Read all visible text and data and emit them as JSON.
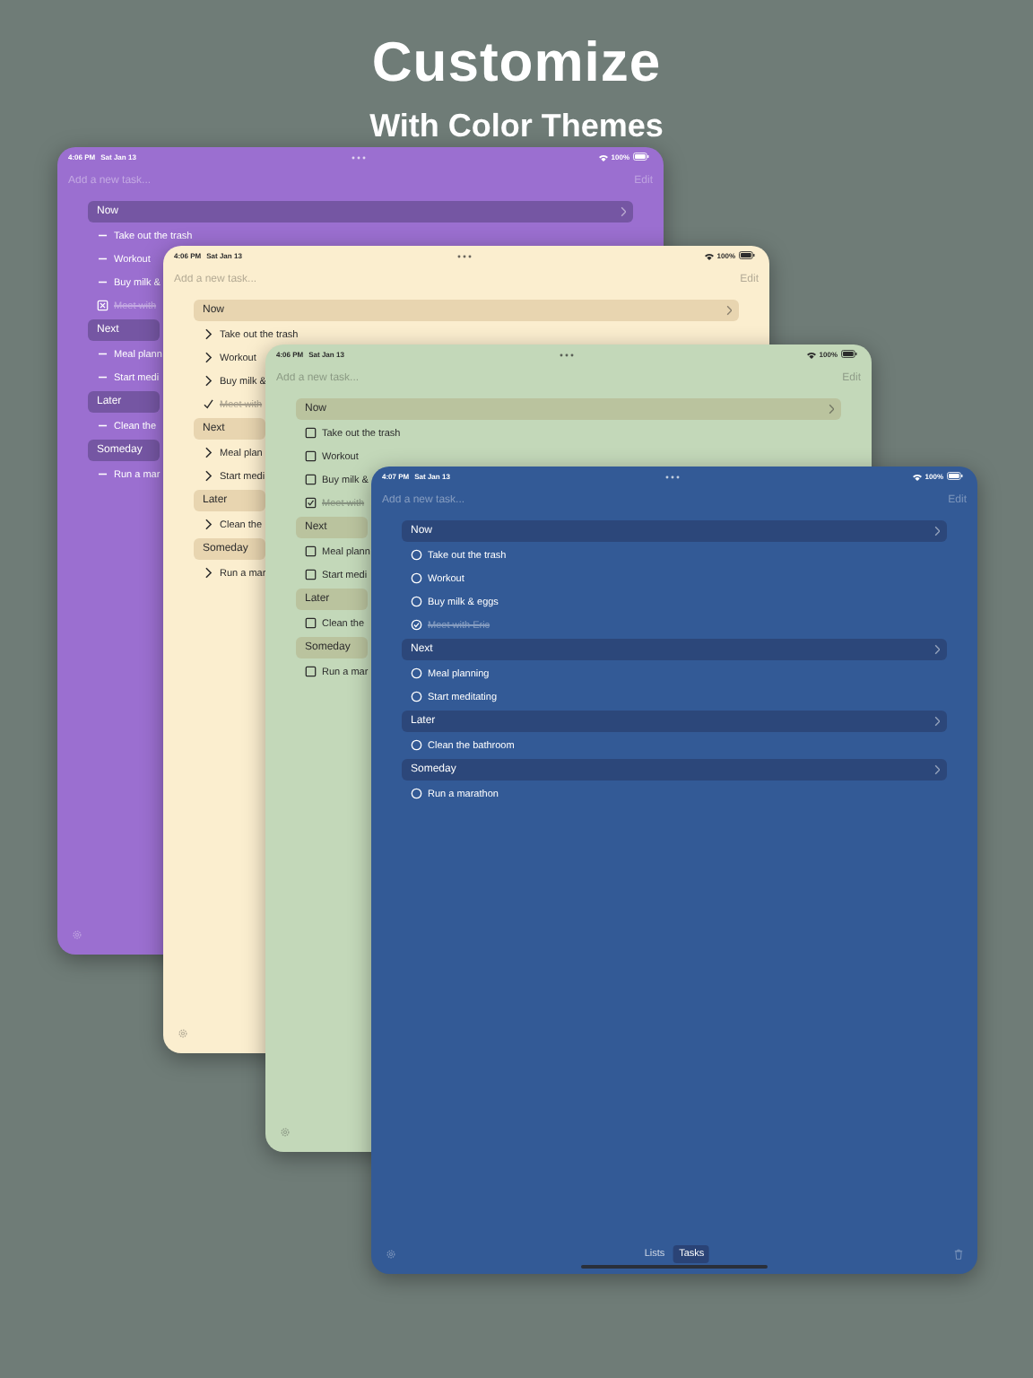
{
  "heading": {
    "title": "Customize",
    "subtitle": "With Color Themes"
  },
  "screens": [
    {
      "color": "#9b6fd0",
      "kind": "dash",
      "status": {
        "time": "4:06 PM",
        "date": "Sat Jan 13",
        "battery": "100%"
      },
      "input": {
        "placeholder": "Add a new task..."
      },
      "edit": "Edit",
      "groups": [
        {
          "title": "Now",
          "tasks": [
            {
              "text": "Take out the trash",
              "done": false
            },
            {
              "text": "Workout",
              "done": false
            },
            {
              "text": "Buy milk &",
              "done": false
            },
            {
              "text": "Meet with",
              "done": true
            }
          ]
        },
        {
          "title": "Next",
          "tasks": [
            {
              "text": "Meal plann",
              "done": false
            },
            {
              "text": "Start medi",
              "done": false
            }
          ]
        },
        {
          "title": "Later",
          "tasks": [
            {
              "text": "Clean the",
              "done": false
            }
          ]
        },
        {
          "title": "Someday",
          "tasks": [
            {
              "text": "Run a mar",
              "done": false
            }
          ]
        }
      ]
    },
    {
      "color": "#fbeecf",
      "kind": "chevron",
      "status": {
        "time": "4:06 PM",
        "date": "Sat Jan 13",
        "battery": "100%"
      },
      "input": {
        "placeholder": "Add a new task..."
      },
      "edit": "Edit",
      "groups": [
        {
          "title": "Now",
          "tasks": [
            {
              "text": "Take out the trash",
              "done": false
            },
            {
              "text": "Workout",
              "done": false
            },
            {
              "text": "Buy milk &",
              "done": false
            },
            {
              "text": "Meet with",
              "done": true
            }
          ]
        },
        {
          "title": "Next",
          "tasks": [
            {
              "text": "Meal plan",
              "done": false
            },
            {
              "text": "Start medi",
              "done": false
            }
          ]
        },
        {
          "title": "Later",
          "tasks": [
            {
              "text": "Clean the",
              "done": false
            }
          ]
        },
        {
          "title": "Someday",
          "tasks": [
            {
              "text": "Run a mar",
              "done": false
            }
          ]
        }
      ]
    },
    {
      "color": "#c3d8b9",
      "kind": "checkbox",
      "status": {
        "time": "4:06 PM",
        "date": "Sat Jan 13",
        "battery": "100%"
      },
      "input": {
        "placeholder": "Add a new task..."
      },
      "edit": "Edit",
      "groups": [
        {
          "title": "Now",
          "tasks": [
            {
              "text": "Take out the trash",
              "done": false
            },
            {
              "text": "Workout",
              "done": false
            },
            {
              "text": "Buy milk &",
              "done": false
            },
            {
              "text": "Meet with",
              "done": true
            }
          ]
        },
        {
          "title": "Next",
          "tasks": [
            {
              "text": "Meal plann",
              "done": false
            },
            {
              "text": "Start medi",
              "done": false
            }
          ]
        },
        {
          "title": "Later",
          "tasks": [
            {
              "text": "Clean the",
              "done": false
            }
          ]
        },
        {
          "title": "Someday",
          "tasks": [
            {
              "text": "Run a mar",
              "done": false
            }
          ]
        }
      ]
    },
    {
      "color": "#335a96",
      "kind": "circle",
      "status": {
        "time": "4:07 PM",
        "date": "Sat Jan 13",
        "battery": "100%"
      },
      "input": {
        "placeholder": "Add a new task..."
      },
      "edit": "Edit",
      "groups": [
        {
          "title": "Now",
          "tasks": [
            {
              "text": "Take out the trash",
              "done": false
            },
            {
              "text": "Workout",
              "done": false
            },
            {
              "text": "Buy milk & eggs",
              "done": false
            },
            {
              "text": "Meet with Eric",
              "done": true
            }
          ]
        },
        {
          "title": "Next",
          "tasks": [
            {
              "text": "Meal planning",
              "done": false
            },
            {
              "text": "Start meditating",
              "done": false
            }
          ]
        },
        {
          "title": "Later",
          "tasks": [
            {
              "text": "Clean the bathroom",
              "done": false
            }
          ]
        },
        {
          "title": "Someday",
          "tasks": [
            {
              "text": "Run a marathon",
              "done": false
            }
          ]
        }
      ],
      "tabs": [
        {
          "label": "Lists",
          "selected": false
        },
        {
          "label": "Tasks",
          "selected": true
        }
      ]
    }
  ]
}
